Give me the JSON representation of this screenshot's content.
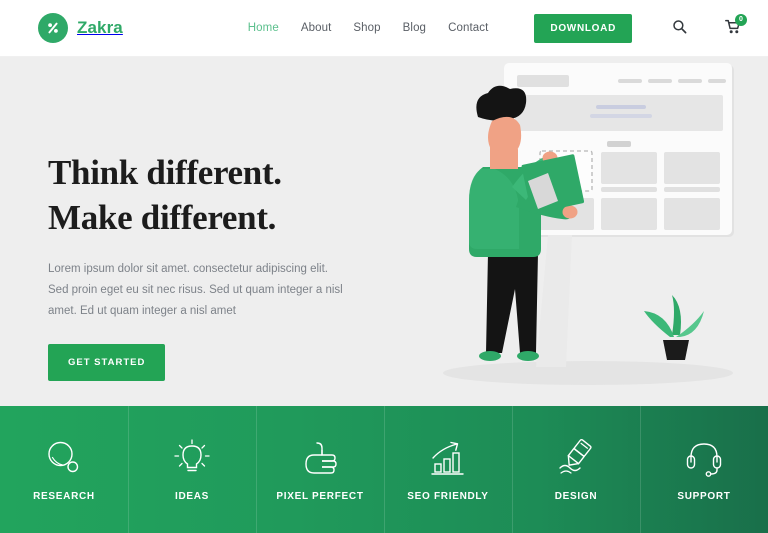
{
  "header": {
    "brand": {
      "name": "Zakra",
      "mark_icon": "percent-logo-icon",
      "accent": "#2fa968"
    },
    "nav": [
      {
        "label": "Home",
        "active": true
      },
      {
        "label": "About",
        "active": false
      },
      {
        "label": "Shop",
        "active": false
      },
      {
        "label": "Blog",
        "active": false
      },
      {
        "label": "Contact",
        "active": false
      }
    ],
    "download_label": "DOWNLOAD",
    "search_icon": "search-icon",
    "cart_icon": "shopping-cart-icon",
    "cart_count": "0",
    "button_color": "#23a455"
  },
  "hero": {
    "title_line1": "Think different.",
    "title_line2": "Make different.",
    "paragraph_line1": "Lorem ipsum dolor sit amet. consectetur adipiscing elit.",
    "paragraph_line2": "Sed proin eget eu sit nec risus. Sed ut quam integer a nisl",
    "paragraph_line3": "amet.  Ed ut quam integer a nisl amet",
    "cta_label": "GET STARTED",
    "background": "#eeeeee",
    "illustration": "person-placing-block-on-wireframe-board"
  },
  "features": {
    "background_gradient_from": "#22a45d",
    "background_gradient_to": "#196f4a",
    "items": [
      {
        "label": "RESEARCH",
        "icon": "magnifier-icon"
      },
      {
        "label": "IDEAS",
        "icon": "lightbulb-icon"
      },
      {
        "label": "PIXEL PERFECT",
        "icon": "thumbs-up-icon"
      },
      {
        "label": "SEO FRIENDLY",
        "icon": "bar-chart-arrow-icon"
      },
      {
        "label": "DESIGN",
        "icon": "marker-pen-icon"
      },
      {
        "label": "SUPPORT",
        "icon": "headset-icon"
      }
    ]
  }
}
